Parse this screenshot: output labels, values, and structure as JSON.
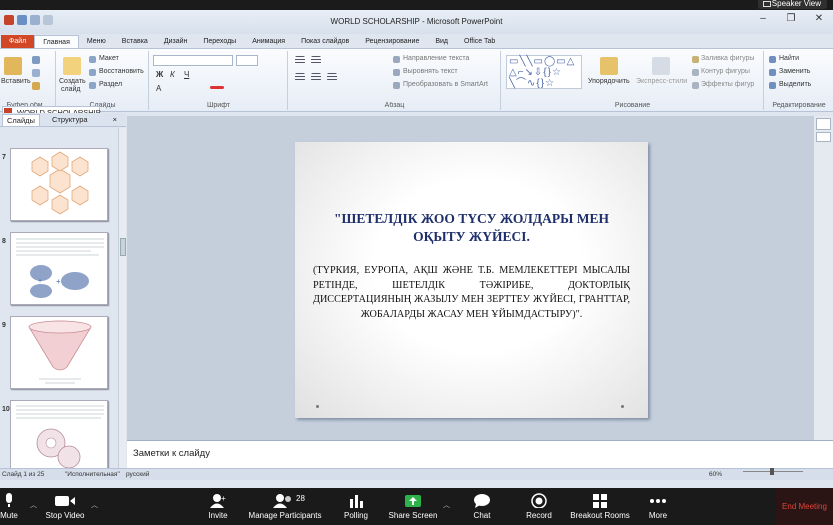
{
  "zoom_top": {
    "speaker_view": "Speaker View"
  },
  "window": {
    "title": "WORLD SCHOLARSHIP - Microsoft PowerPoint"
  },
  "ribbon_tabs": [
    "Файл",
    "Главная",
    "Меню",
    "Вставка",
    "Дизайн",
    "Переходы",
    "Анимация",
    "Показ слайдов",
    "Рецензирование",
    "Вид",
    "Office Tab"
  ],
  "ribbon": {
    "clipboard": {
      "paste": "Вставить",
      "label": "Буфер обм..."
    },
    "slides": {
      "new": "Создать",
      "new2": "слайд",
      "layout": "Макет",
      "reset": "Восстановить",
      "section": "Раздел",
      "label": "Слайды"
    },
    "font": {
      "label": "Шрифт"
    },
    "paragraph": {
      "text_dir": "Направление текста",
      "align_text": "Выровнять текст",
      "smartart": "Преобразовать в SmartArt",
      "label": "Абзац"
    },
    "drawing": {
      "arrange": "Упорядочить",
      "quick_styles": "Экспресс-стили",
      "fill": "Заливка фигуры",
      "outline": "Контур фигуры",
      "effects": "Эффекты фигур",
      "label": "Рисование"
    },
    "editing": {
      "find": "Найти",
      "replace": "Заменить",
      "select": "Выделить",
      "label": "Редактирование"
    }
  },
  "doc_tab": "WORLD SCHOLARSHIP",
  "pane": {
    "tab_slides": "Слайды",
    "tab_outline": "Структура",
    "close": "×"
  },
  "thumbnails": [
    {
      "num": "7"
    },
    {
      "num": "8"
    },
    {
      "num": "9"
    },
    {
      "num": "10"
    }
  ],
  "slide": {
    "title": "\"ШЕТЕЛДІК ЖОО ТҮСУ ЖОЛДАРЫ МЕН ОҚЫТУ ЖҮЙЕСІ.",
    "body": "(ТҮРКИЯ, ЕУРОПА, АҚШ ЖӘНЕ Т.Б. МЕМЛЕКЕТТЕРІ МЫСАЛЫ РЕТІНДЕ, ШЕТЕЛДІК ТӘЖІРИБЕ, ДОКТОРЛЫҚ ДИССЕРТАЦИЯНЫҢ ЖАЗЫЛУ МЕН ЗЕРТТЕУ ЖҮЙЕСІ, ГРАНТТАР, ЖОБАЛАРДЫ ЖАСАУ МЕН ҰЙЫМДАСТЫРУ)\"."
  },
  "notes": {
    "placeholder": "Заметки к слайду"
  },
  "status": {
    "slide": "Слайд 1 из 25",
    "theme": "\"Исполнительная\"",
    "lang": "русский",
    "zoom": "60%"
  },
  "zoom_toolbar": {
    "mute": "Mute",
    "stop_video": "Stop Video",
    "invite": "Invite",
    "participants": "Manage Participants",
    "participants_count": "28",
    "polling": "Polling",
    "share": "Share Screen",
    "chat": "Chat",
    "record": "Record",
    "breakout": "Breakout Rooms",
    "more": "More",
    "end": "End Meeting"
  },
  "colors": {
    "title_text": "#1f2f6b",
    "file_tab": "#d24726",
    "share_green": "#2db34a",
    "end_red": "#e0463a"
  }
}
